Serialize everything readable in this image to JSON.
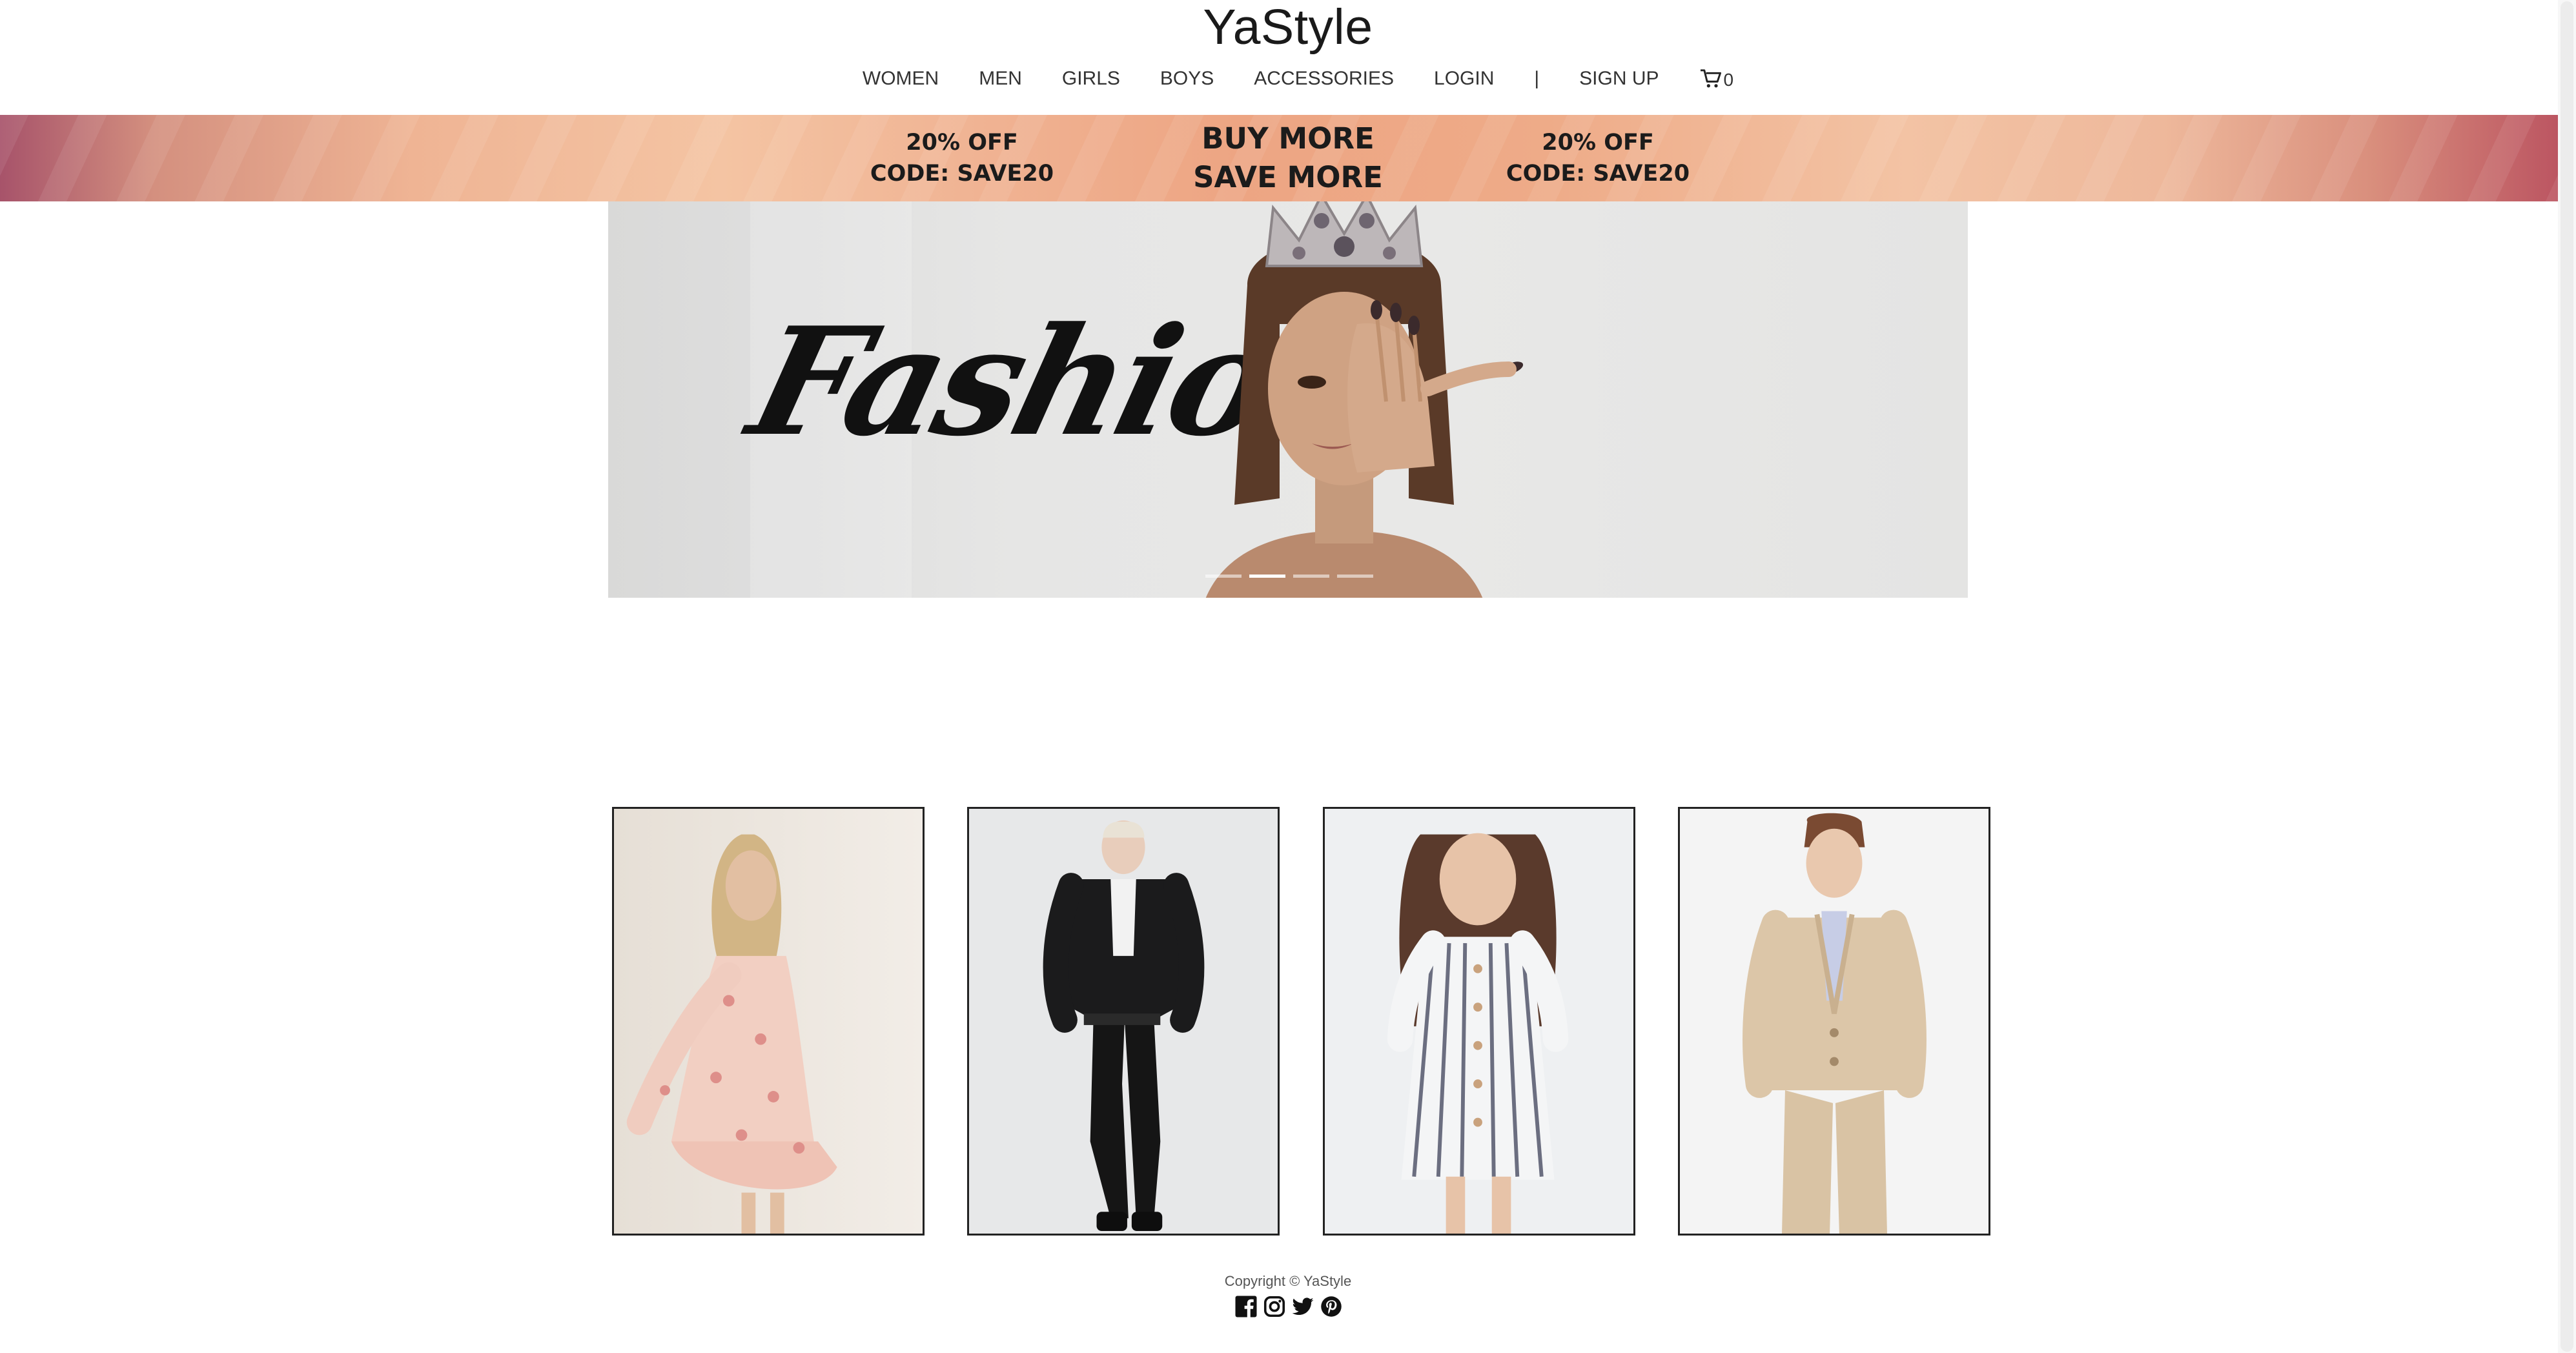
{
  "header": {
    "brand": "YaStyle",
    "nav": [
      "WOMEN",
      "MEN",
      "GIRLS",
      "BOYS",
      "ACCESSORIES",
      "LOGIN",
      "|",
      "SIGN UP"
    ],
    "cart_count": "0"
  },
  "promo": {
    "left_line1": "20% OFF",
    "left_line2": "CODE: SAVE20",
    "mid_line1": "BUY MORE",
    "mid_line2": "SAVE MORE",
    "right_line1": "20% OFF",
    "right_line2": "CODE: SAVE20"
  },
  "hero": {
    "script_text": "Fashion",
    "slide_count": 4,
    "active_slide": 2
  },
  "products": [
    {
      "icon": "woman-floral-dress-photo"
    },
    {
      "icon": "man-leather-jacket-photo"
    },
    {
      "icon": "girl-striped-dress-photo"
    },
    {
      "icon": "boy-beige-suit-photo"
    }
  ],
  "footer": {
    "copyright": "Copyright © YaStyle",
    "social": [
      "facebook-icon",
      "instagram-icon",
      "twitter-icon",
      "pinterest-icon"
    ]
  }
}
